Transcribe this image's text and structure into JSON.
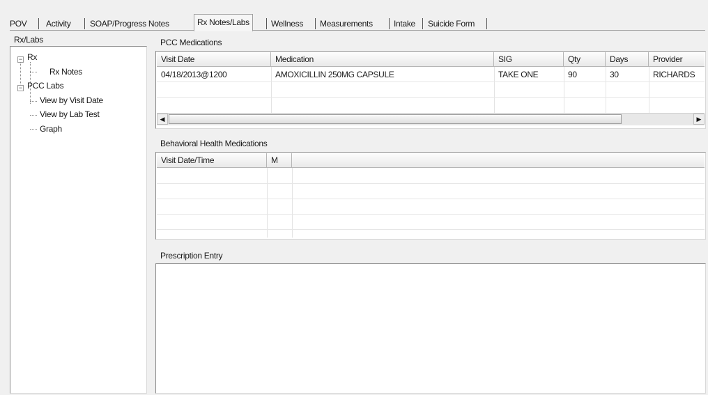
{
  "tabs": [
    {
      "label": "POV"
    },
    {
      "label": "Activity"
    },
    {
      "label": "SOAP/Progress Notes"
    },
    {
      "label": "Rx Notes/Labs"
    },
    {
      "label": "Wellness"
    },
    {
      "label": "Measurements"
    },
    {
      "label": "Intake"
    },
    {
      "label": "Suicide Form"
    }
  ],
  "left_panel": {
    "title": "Rx/Labs",
    "tree": [
      {
        "label": "Rx"
      },
      {
        "label": "Rx Notes"
      },
      {
        "label": "PCC Labs"
      },
      {
        "label": "View by Visit Date"
      },
      {
        "label": "View by Lab Test"
      },
      {
        "label": "Graph"
      }
    ]
  },
  "pcc_medications": {
    "title": "PCC Medications",
    "columns": [
      "Visit Date",
      "Medication",
      "SIG",
      "Qty",
      "Days",
      "Provider"
    ],
    "rows": [
      {
        "visit_date": "04/18/2013@1200",
        "medication": "AMOXICILLIN 250MG CAPSULE",
        "sig": "TAKE ONE",
        "qty": "90",
        "days": "30",
        "provider": "RICHARDS"
      }
    ]
  },
  "behavioral_health": {
    "title": "Behavioral Health Medications",
    "columns": [
      "Visit Date/Time",
      "M"
    ]
  },
  "prescription_entry": {
    "title": "Prescription Entry"
  },
  "icons": {
    "tree_collapse": "minus-box-icon",
    "scroll_left": "arrow-left-icon",
    "scroll_right": "arrow-right-icon"
  }
}
